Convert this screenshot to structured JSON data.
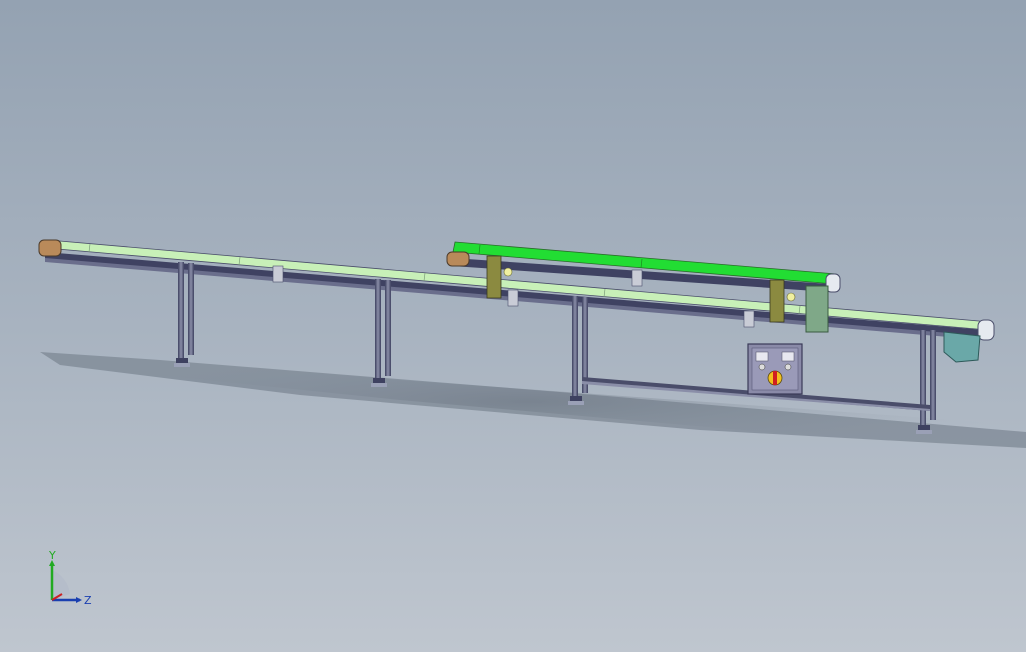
{
  "viewport": {
    "background_top": "#94a2b2",
    "background_bottom": "#bfc6cf"
  },
  "model": {
    "belt_color_long": "#c8f0b8",
    "belt_color_short": "#22dd33",
    "frame_color": "#4a4d6a",
    "leg_color": "#5b5f80",
    "panel_color": "#8a8aa8",
    "guard_color": "#7fa888",
    "bracket_color": "#6aa8a8",
    "mount_color": "#8b8a40"
  },
  "triad": {
    "y_label": "Y",
    "z_label": "Z",
    "y_color": "#22aa22",
    "z_color": "#1a3fb0",
    "x_color": "#cc2222"
  }
}
